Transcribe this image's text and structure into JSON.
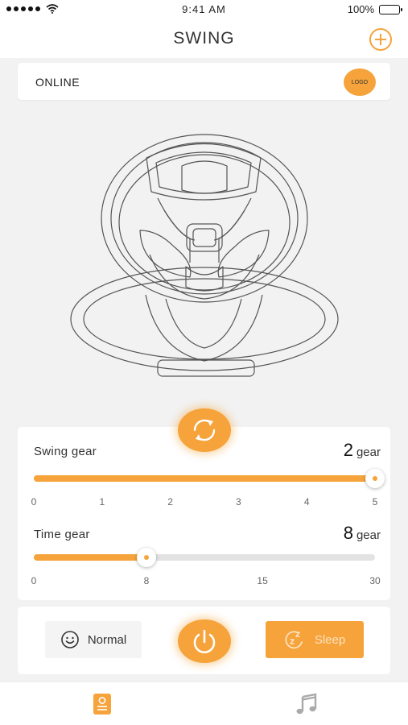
{
  "status_bar": {
    "time": "9:41 AM",
    "battery": "100%"
  },
  "header": {
    "title": "SWING"
  },
  "device": {
    "status": "ONLINE",
    "logo": "LOGO"
  },
  "swing": {
    "label": "Swing gear",
    "value": "2",
    "unit": "gear",
    "level_fraction": 1.0,
    "ticks": [
      "0",
      "1",
      "2",
      "3",
      "4",
      "5"
    ]
  },
  "time": {
    "label": "Time gear",
    "value": "8",
    "unit": "gear",
    "level_value": 8,
    "max": 30,
    "ticks": [
      "0",
      "8",
      "15",
      "30"
    ]
  },
  "modes": {
    "normal": "Normal",
    "sleep": "Sleep"
  },
  "colors": {
    "accent": "#f5a33a",
    "background": "#f2f2f2",
    "card": "#ffffff"
  },
  "icons": {
    "add": "plus-circle-icon",
    "sync": "sync-icon",
    "power": "power-icon",
    "normal": "smiley-icon",
    "sleep": "sleep-moon-icon",
    "tab1": "device-icon",
    "tab2": "music-note-icon"
  }
}
